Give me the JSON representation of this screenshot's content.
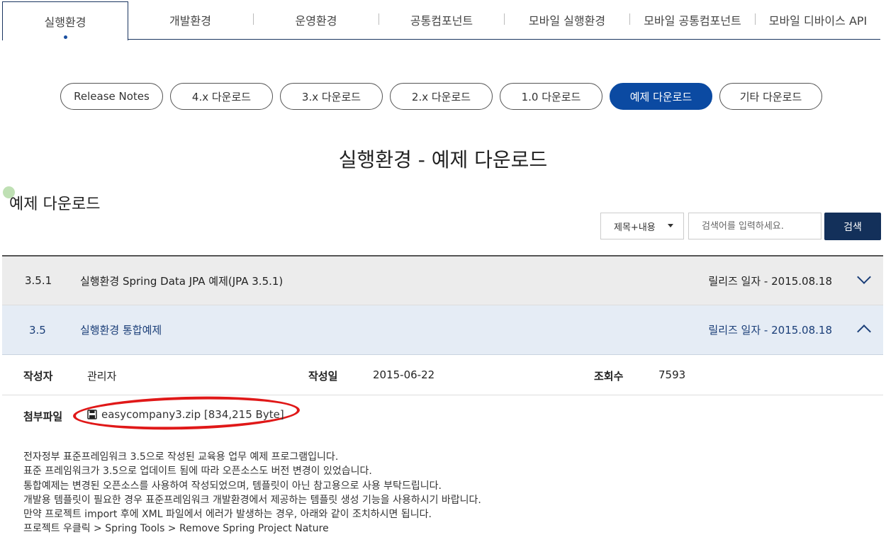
{
  "top_tabs": [
    {
      "label": "실행환경",
      "active": true
    },
    {
      "label": "개발환경"
    },
    {
      "label": "운영환경"
    },
    {
      "label": "공통컴포넌트"
    },
    {
      "label": "모바일 실행환경"
    },
    {
      "label": "모바일 공통컴포넌트"
    },
    {
      "label": "모바일 디바이스 API"
    }
  ],
  "pills": [
    {
      "label": "Release Notes"
    },
    {
      "label": "4.x 다운로드"
    },
    {
      "label": "3.x 다운로드"
    },
    {
      "label": "2.x 다운로드"
    },
    {
      "label": "1.0 다운로드"
    },
    {
      "label": "예제 다운로드",
      "active": true
    },
    {
      "label": "기타 다운로드"
    }
  ],
  "page_title": "실행환경 - 예제 다운로드",
  "section_title": "예제 다운로드",
  "search": {
    "select_value": "제목+내용",
    "placeholder": "검색어를 입력하세요.",
    "button_label": "검색"
  },
  "rows": [
    {
      "version": "3.5.1",
      "title": "실행환경 Spring Data JPA 예제(JPA 3.5.1)",
      "date": "릴리즈 일자 - 2015.08.18",
      "expanded": false
    },
    {
      "version": "3.5",
      "title": "실행환경 통합예제",
      "date": "릴리즈 일자 - 2015.08.18",
      "expanded": true
    }
  ],
  "detail": {
    "author_label": "작성자",
    "author": "관리자",
    "date_label": "작성일",
    "date": "2015-06-22",
    "views_label": "조회수",
    "views": "7593",
    "attach_label": "첨부파일",
    "file": "easycompany3.zip [834,215 Byte]",
    "description": [
      "전자정부 표준프레임워크 3.5으로 작성된 교육용 업무 예제 프로그램입니다.",
      "표준 프레임워크가 3.5으로 업데이트 됨에 따라 오픈소스도 버전 변경이 있었습니다.",
      "통합예제는 변경된 오픈소스를 사용하여 작성되었으며, 템플릿이 아닌 참고용으로 사용 부탁드립니다.",
      "개발용 템플릿이 필요한 경우 표준프레임워크 개발환경에서 제공하는 템플릿 생성 기능을 사용하시기 바랍니다.",
      "만약 프로젝트 import 후에 XML 파일에서 에러가 발생하는 경우, 아래와 같이 조치하시면 됩니다.",
      "프로젝트 우클릭 > Spring Tools > Remove Spring Project Nature"
    ]
  },
  "colors": {
    "primary": "#0b4aa2",
    "navy": "#13305a",
    "highlight_ring": "#e01818"
  }
}
